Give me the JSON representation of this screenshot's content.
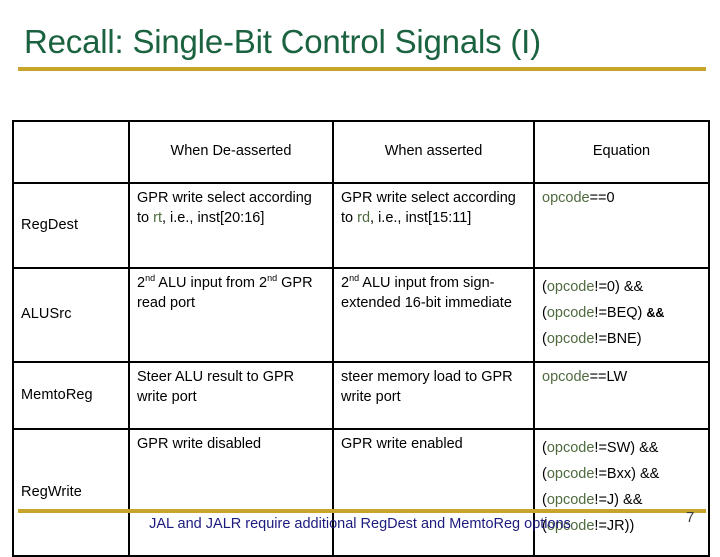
{
  "slide": {
    "title": "Recall: Single-Bit Control Signals (I)",
    "page_number": "7",
    "footer_note": "JAL and JALR require additional RegDest and MemtoReg options",
    "colors": {
      "title_green": "#1b6340",
      "rule_gold": "#c9a42b",
      "label_orange": "#e2a93c",
      "keyword_green": "#4f6b3f",
      "footer_navy": "#1b1b7e",
      "page_number_gray": "#3a3a3a",
      "border_black": "#000000",
      "background": "#ffffff"
    }
  },
  "table": {
    "headers": {
      "signal": "",
      "deasserted": "When De-asserted",
      "asserted": "When asserted",
      "equation": "Equation"
    },
    "rows": [
      {
        "signal": "RegDest",
        "deasserted_parts": {
          "a": "GPR write select according to ",
          "kw": "rt",
          "b": ", i.e., inst[20:16]"
        },
        "deasserted_plain": "GPR write select according to rt, i.e., inst[20:16]",
        "asserted_parts": {
          "a": "GPR write select according to ",
          "kw": "rd",
          "b": ", i.e., inst[15:11]"
        },
        "asserted_plain": "GPR write select according to rd, i.e., inst[15:11]",
        "equation_lines": [
          {
            "kw": "opcode",
            "op": "==0"
          }
        ],
        "equation_plain": "opcode==0"
      },
      {
        "signal": "ALUSrc",
        "deasserted_plain": "2nd ALU input from 2nd GPR read port",
        "deasserted_parts": {
          "n1": "2",
          "s1": "nd",
          "mid": " ALU input from ",
          "n2": "2",
          "s2": "nd",
          "tail": " GPR read port"
        },
        "asserted_plain": "2nd ALU input from sign-extended 16-bit immediate",
        "asserted_parts": {
          "n1": "2",
          "s1": "nd",
          "tail": " ALU input from sign-extended 16-bit immediate"
        },
        "equation_lines": [
          {
            "pre": "(",
            "kw": "opcode",
            "op": "!=0) &&",
            "amp": ""
          },
          {
            "pre": "(",
            "kw": "opcode",
            "op": "!=BEQ) ",
            "amp": "&&"
          },
          {
            "pre": "(",
            "kw": "opcode",
            "op": "!=BNE)",
            "amp": ""
          }
        ],
        "equation_plain": "(opcode!=0) && (opcode!=BEQ) && (opcode!=BNE)"
      },
      {
        "signal": "MemtoReg",
        "deasserted_plain": "Steer ALU result to GPR write port",
        "asserted_plain": "steer memory load to GPR write port",
        "equation_lines": [
          {
            "kw": "opcode",
            "op": "==LW"
          }
        ],
        "equation_plain": "opcode==LW"
      },
      {
        "signal": "RegWrite",
        "deasserted_plain": "GPR write disabled",
        "asserted_plain": "GPR write enabled",
        "equation_lines": [
          {
            "pre": "(",
            "kw": "opcode",
            "op": "!=SW) &&"
          },
          {
            "pre": "(",
            "kw": "opcode",
            "op": "!=Bxx) &&"
          },
          {
            "pre": "(",
            "kw": "opcode",
            "op": "!=J) &&"
          },
          {
            "pre": "(",
            "kw": "opcode",
            "op": "!=JR))"
          }
        ],
        "equation_plain": "(opcode!=SW) && (opcode!=Bxx) && (opcode!=J) && (opcode!=JR))"
      }
    ]
  }
}
